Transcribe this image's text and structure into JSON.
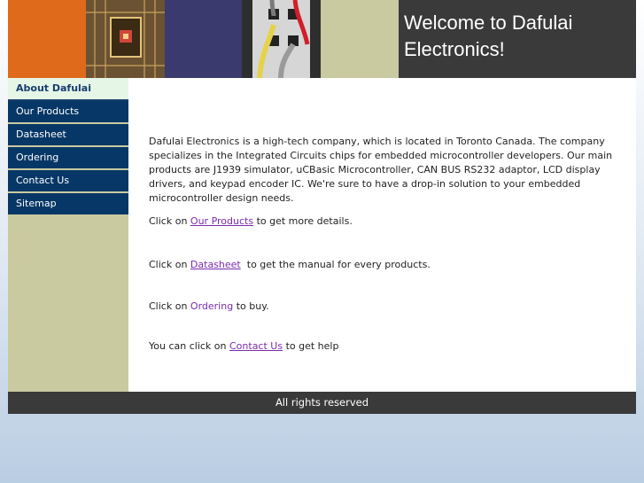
{
  "header": {
    "title": "Welcome to Dafulai Electronics!"
  },
  "sidebar": {
    "items": [
      {
        "label": "About Dafulai",
        "active": true
      },
      {
        "label": "Our Products"
      },
      {
        "label": "Datasheet"
      },
      {
        "label": "Ordering"
      },
      {
        "label": "Contact Us"
      },
      {
        "label": "Sitemap"
      }
    ]
  },
  "content": {
    "intro": "Dafulai Electronics is a high-tech company, which is located in Toronto Canada. The company specializes in the Integrated Circuits chips for embedded microcontroller developers. Our main products are J1939 simulator, uCBasic Microcontroller, CAN BUS RS232 adaptor, LCD display drivers, and keypad encoder IC. We're sure to have a drop-in solution to your embedded microcontroller design needs.",
    "products": {
      "before": "Click on",
      "link": "Our Products",
      "after": "to get more details."
    },
    "datasheet": {
      "before": "Click on",
      "link": "Datasheet",
      "after": "to get the manual for every products."
    },
    "ordering": {
      "before": "Click on",
      "link": "Ordering",
      "after": "to buy."
    },
    "contact": {
      "before": "You can click on",
      "link": "Contact Us",
      "after": "to get help"
    }
  },
  "footer": {
    "text": "All rights reserved"
  },
  "colors": {
    "nav_bg": "#073766",
    "sidebar_bg": "#c9caa0",
    "header_orange": "#e06a1c",
    "header_dark": "#3a3a3a",
    "link": "#7a2bb0"
  }
}
